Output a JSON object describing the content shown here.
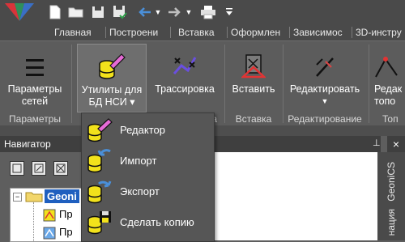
{
  "ribbon_tabs": [
    "Главная",
    "Построени",
    "Вставка",
    "Оформлен",
    "Зависимос",
    "3D-инстру"
  ],
  "ribbon": {
    "network_params": {
      "line1": "Параметры",
      "line2": "сетей"
    },
    "utilities": {
      "line1": "Утилиты для",
      "line2": "БД НСИ"
    },
    "tracing": "Трассировка",
    "insert": "Вставить",
    "edit": "Редактировать",
    "right_partial": {
      "line1": "Редак",
      "line2": "топо"
    },
    "group_labels": {
      "params": "Параметры",
      "ca": "а",
      "insert": "Вставка",
      "editing": "Редактирование",
      "topo": "Топ"
    }
  },
  "navigator": {
    "title": "Навигатор",
    "pin": "⊥",
    "close": "×",
    "tree_root": "Geoni",
    "tree_child1": "Пр",
    "tree_child2": "Пр"
  },
  "side_tabs": {
    "geonics": "GeoniCS",
    "partial": "нация"
  },
  "dropdown": [
    {
      "label": "Редактор",
      "icon": "db-pencil-icon"
    },
    {
      "label": "Импорт",
      "icon": "db-import-icon"
    },
    {
      "label": "Экспорт",
      "icon": "db-export-icon"
    },
    {
      "label": "Сделать копию",
      "icon": "db-save-icon"
    }
  ],
  "colors": {
    "accent_yellow": "#f2e21b",
    "pencil_pink": "#e66ad6",
    "arrow_blue": "#4a8fd8"
  }
}
